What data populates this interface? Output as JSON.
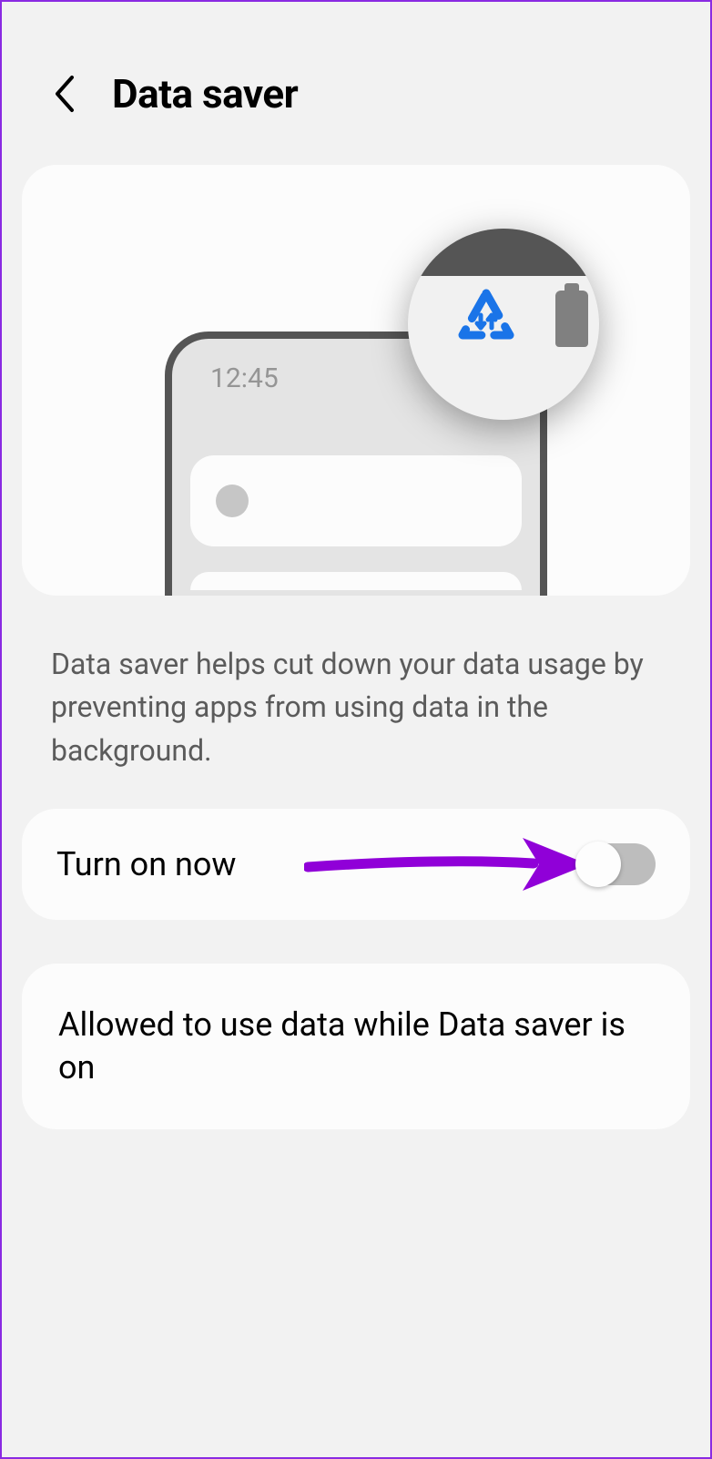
{
  "header": {
    "title": "Data saver"
  },
  "illustration": {
    "time": "12:45"
  },
  "description": "Data saver helps cut down your data usage by preventing apps from using data in the background.",
  "toggle": {
    "label": "Turn on now",
    "state": "off"
  },
  "allowed": {
    "label": "Allowed to use data while Data saver is on"
  },
  "colors": {
    "accent": "#1a74e8",
    "annotation": "#9000d8"
  }
}
